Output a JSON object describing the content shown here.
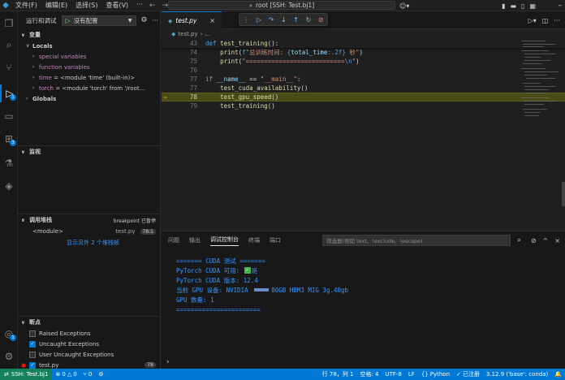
{
  "titlebar": {
    "menu": [
      "文件(F)",
      "编辑(E)",
      "选择(S)",
      "查看(V)",
      "···"
    ],
    "search": "root [SSH: Test.bj1]"
  },
  "sidebar": {
    "header": "运行和调试",
    "config": "没有配置",
    "variables_title": "变量",
    "locals_label": "Locals",
    "variables": [
      {
        "name": "special variables",
        "value": ""
      },
      {
        "name": "function variables",
        "value": ""
      },
      {
        "name": "time",
        "value": "= <module 'time' (built-in)>"
      },
      {
        "name": "torch",
        "value": "= <module 'torch' from '/root..."
      }
    ],
    "globals_label": "Globals",
    "watch_title": "监视",
    "callstack_title": "调用堆栈",
    "callstack_status": "breakpoint 已暂停",
    "callstack_frame": {
      "name": "<module>",
      "file": "test.py",
      "line": "78:1"
    },
    "callstack_more": "显示另外 2 个堆栈帧",
    "breakpoints_title": "断点",
    "breakpoints": [
      {
        "label": "Raised Exceptions",
        "checked": false
      },
      {
        "label": "Uncaught Exceptions",
        "checked": true
      },
      {
        "label": "User Uncaught Exceptions",
        "checked": false
      },
      {
        "label": "test.py",
        "checked": true,
        "line": "78"
      }
    ]
  },
  "editor": {
    "tab_label": "test.py",
    "breadcrumb": [
      "test.py",
      "..."
    ],
    "lines": [
      {
        "n": "43",
        "code": "def test_training():"
      },
      {
        "n": "74",
        "code": "    print(f\"总训练时间: {total_time:.2f} 秒\")"
      },
      {
        "n": "75",
        "code": "    print(\"===========================\\n\")"
      },
      {
        "n": "76",
        "code": ""
      },
      {
        "n": "77",
        "code": "if __name__ == \"__main__\":"
      },
      {
        "n": "77",
        "code": "    test_cuda_availability()"
      },
      {
        "n": "78",
        "code": "    test_gpu_speed()"
      },
      {
        "n": "79",
        "code": "    test_training()"
      }
    ]
  },
  "panel": {
    "tabs": [
      "问题",
      "输出",
      "调试控制台",
      "终端",
      "端口"
    ],
    "filter_placeholder": "筛选器(例如 text、!exclude、\\escape)",
    "console_lines": [
      "======= CUDA 测试 =======",
      "PyTorch CUDA 可用: ",
      "PyTorch CUDA 版本: 12.4",
      "当前 GPU 设备: NVIDIA ",
      "GPU 数量: 1",
      "======================="
    ],
    "console_ok": "是",
    "gpu_suffix": "80GB HBM3 MIG 3g.40gb"
  },
  "statusbar": {
    "remote": "SSH: Test.bj1",
    "errors": "0",
    "warnings": "0",
    "ports": "0",
    "position": "行 78，列 1",
    "spaces": "空格: 4",
    "encoding": "UTF-8",
    "eol": "LF",
    "language": "Python",
    "registered": "已注册",
    "interpreter": "3.12.9 ('base': conda)"
  },
  "colors": {
    "accent": "#0078d4",
    "remote": "#16825d",
    "current_line": "#4b4b18"
  }
}
